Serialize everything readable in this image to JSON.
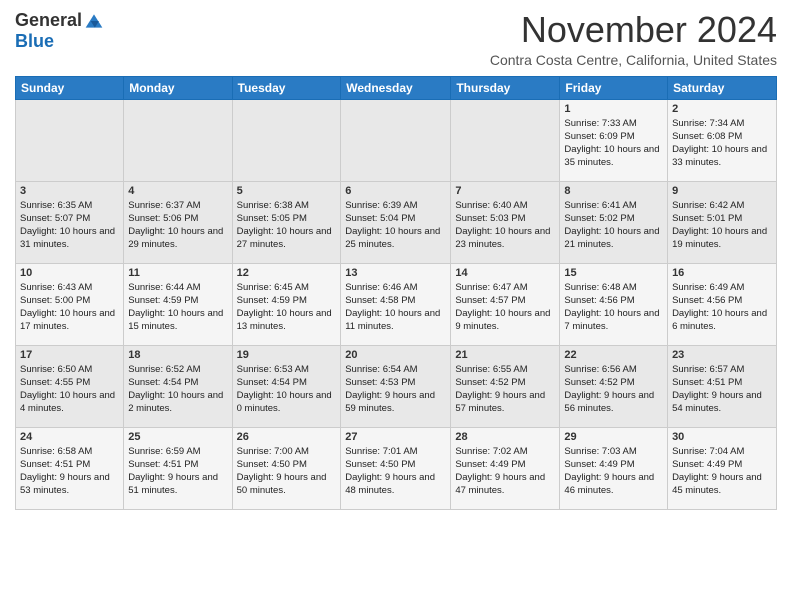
{
  "logo": {
    "general": "General",
    "blue": "Blue"
  },
  "header": {
    "month": "November 2024",
    "location": "Contra Costa Centre, California, United States"
  },
  "weekdays": [
    "Sunday",
    "Monday",
    "Tuesday",
    "Wednesday",
    "Thursday",
    "Friday",
    "Saturday"
  ],
  "weeks": [
    [
      {
        "day": "",
        "info": ""
      },
      {
        "day": "",
        "info": ""
      },
      {
        "day": "",
        "info": ""
      },
      {
        "day": "",
        "info": ""
      },
      {
        "day": "",
        "info": ""
      },
      {
        "day": "1",
        "info": "Sunrise: 7:33 AM\nSunset: 6:09 PM\nDaylight: 10 hours\nand 35 minutes."
      },
      {
        "day": "2",
        "info": "Sunrise: 7:34 AM\nSunset: 6:08 PM\nDaylight: 10 hours\nand 33 minutes."
      }
    ],
    [
      {
        "day": "3",
        "info": "Sunrise: 6:35 AM\nSunset: 5:07 PM\nDaylight: 10 hours\nand 31 minutes."
      },
      {
        "day": "4",
        "info": "Sunrise: 6:37 AM\nSunset: 5:06 PM\nDaylight: 10 hours\nand 29 minutes."
      },
      {
        "day": "5",
        "info": "Sunrise: 6:38 AM\nSunset: 5:05 PM\nDaylight: 10 hours\nand 27 minutes."
      },
      {
        "day": "6",
        "info": "Sunrise: 6:39 AM\nSunset: 5:04 PM\nDaylight: 10 hours\nand 25 minutes."
      },
      {
        "day": "7",
        "info": "Sunrise: 6:40 AM\nSunset: 5:03 PM\nDaylight: 10 hours\nand 23 minutes."
      },
      {
        "day": "8",
        "info": "Sunrise: 6:41 AM\nSunset: 5:02 PM\nDaylight: 10 hours\nand 21 minutes."
      },
      {
        "day": "9",
        "info": "Sunrise: 6:42 AM\nSunset: 5:01 PM\nDaylight: 10 hours\nand 19 minutes."
      }
    ],
    [
      {
        "day": "10",
        "info": "Sunrise: 6:43 AM\nSunset: 5:00 PM\nDaylight: 10 hours\nand 17 minutes."
      },
      {
        "day": "11",
        "info": "Sunrise: 6:44 AM\nSunset: 4:59 PM\nDaylight: 10 hours\nand 15 minutes."
      },
      {
        "day": "12",
        "info": "Sunrise: 6:45 AM\nSunset: 4:59 PM\nDaylight: 10 hours\nand 13 minutes."
      },
      {
        "day": "13",
        "info": "Sunrise: 6:46 AM\nSunset: 4:58 PM\nDaylight: 10 hours\nand 11 minutes."
      },
      {
        "day": "14",
        "info": "Sunrise: 6:47 AM\nSunset: 4:57 PM\nDaylight: 10 hours\nand 9 minutes."
      },
      {
        "day": "15",
        "info": "Sunrise: 6:48 AM\nSunset: 4:56 PM\nDaylight: 10 hours\nand 7 minutes."
      },
      {
        "day": "16",
        "info": "Sunrise: 6:49 AM\nSunset: 4:56 PM\nDaylight: 10 hours\nand 6 minutes."
      }
    ],
    [
      {
        "day": "17",
        "info": "Sunrise: 6:50 AM\nSunset: 4:55 PM\nDaylight: 10 hours\nand 4 minutes."
      },
      {
        "day": "18",
        "info": "Sunrise: 6:52 AM\nSunset: 4:54 PM\nDaylight: 10 hours\nand 2 minutes."
      },
      {
        "day": "19",
        "info": "Sunrise: 6:53 AM\nSunset: 4:54 PM\nDaylight: 10 hours\nand 0 minutes."
      },
      {
        "day": "20",
        "info": "Sunrise: 6:54 AM\nSunset: 4:53 PM\nDaylight: 9 hours\nand 59 minutes."
      },
      {
        "day": "21",
        "info": "Sunrise: 6:55 AM\nSunset: 4:52 PM\nDaylight: 9 hours\nand 57 minutes."
      },
      {
        "day": "22",
        "info": "Sunrise: 6:56 AM\nSunset: 4:52 PM\nDaylight: 9 hours\nand 56 minutes."
      },
      {
        "day": "23",
        "info": "Sunrise: 6:57 AM\nSunset: 4:51 PM\nDaylight: 9 hours\nand 54 minutes."
      }
    ],
    [
      {
        "day": "24",
        "info": "Sunrise: 6:58 AM\nSunset: 4:51 PM\nDaylight: 9 hours\nand 53 minutes."
      },
      {
        "day": "25",
        "info": "Sunrise: 6:59 AM\nSunset: 4:51 PM\nDaylight: 9 hours\nand 51 minutes."
      },
      {
        "day": "26",
        "info": "Sunrise: 7:00 AM\nSunset: 4:50 PM\nDaylight: 9 hours\nand 50 minutes."
      },
      {
        "day": "27",
        "info": "Sunrise: 7:01 AM\nSunset: 4:50 PM\nDaylight: 9 hours\nand 48 minutes."
      },
      {
        "day": "28",
        "info": "Sunrise: 7:02 AM\nSunset: 4:49 PM\nDaylight: 9 hours\nand 47 minutes."
      },
      {
        "day": "29",
        "info": "Sunrise: 7:03 AM\nSunset: 4:49 PM\nDaylight: 9 hours\nand 46 minutes."
      },
      {
        "day": "30",
        "info": "Sunrise: 7:04 AM\nSunset: 4:49 PM\nDaylight: 9 hours\nand 45 minutes."
      }
    ]
  ]
}
